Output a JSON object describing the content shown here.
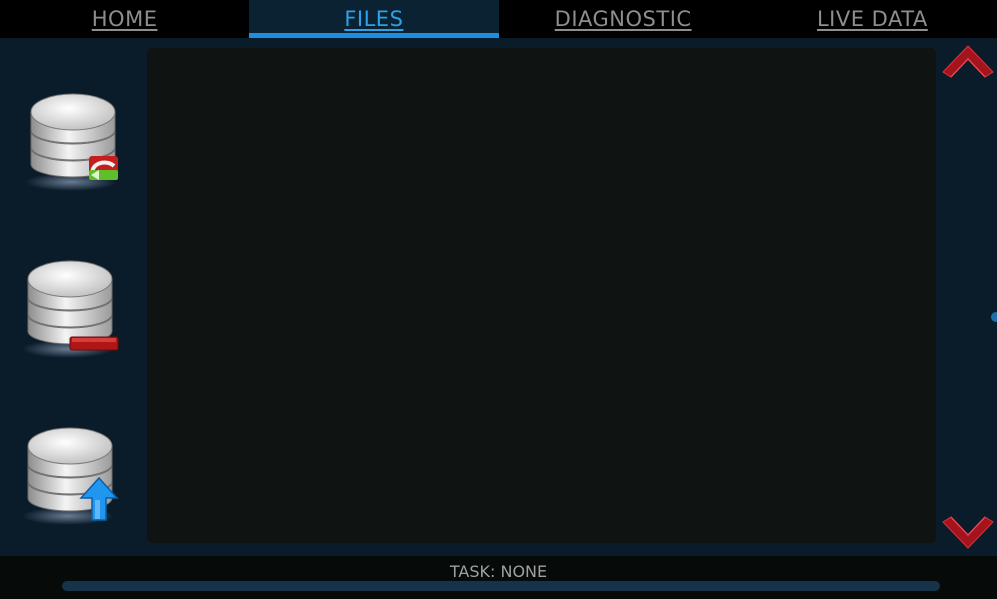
{
  "nav": {
    "tabs": [
      {
        "label": "HOME",
        "active": false
      },
      {
        "label": "FILES",
        "active": true
      },
      {
        "label": "DIAGNOSTIC",
        "active": false
      },
      {
        "label": "LIVE DATA",
        "active": false
      }
    ]
  },
  "sidebar": {
    "buttons": [
      {
        "icon": "database-sync-icon"
      },
      {
        "icon": "database-remove-icon"
      },
      {
        "icon": "database-upload-icon"
      }
    ]
  },
  "status": {
    "task_text": "TASK: NONE",
    "progress": 0
  },
  "colors": {
    "accent": "#1e8ee0",
    "chevron": "#a3141c",
    "background": "#0a1b29",
    "panel": "#0f1311"
  }
}
